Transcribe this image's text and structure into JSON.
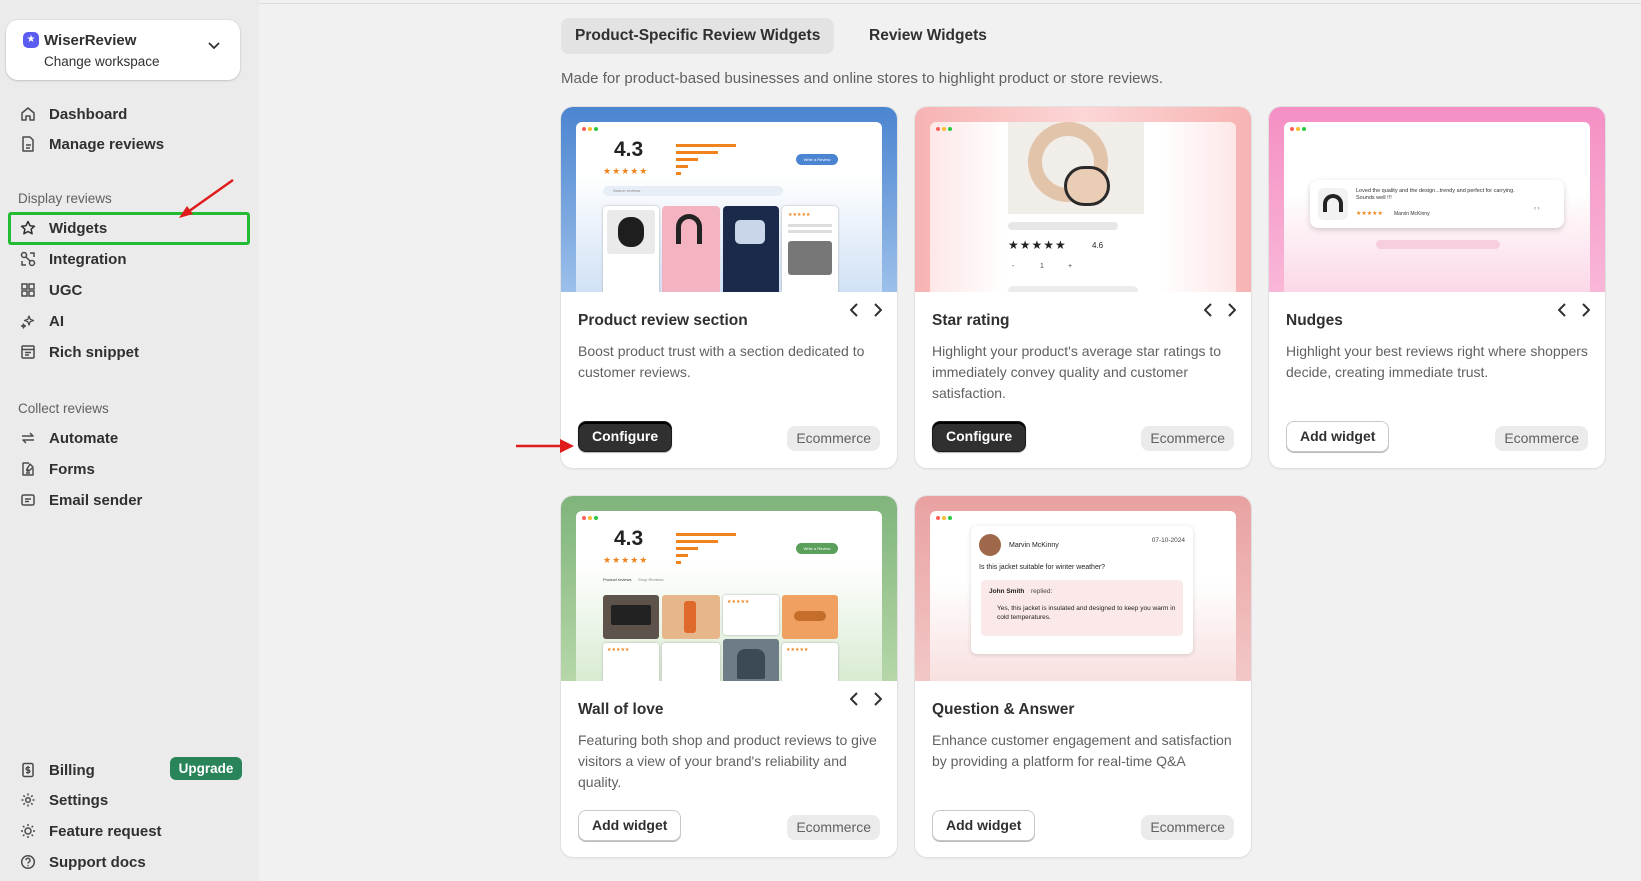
{
  "workspace": {
    "name": "WiserReview",
    "subtitle": "Change workspace"
  },
  "nav_main": [
    {
      "label": "Dashboard",
      "icon": "home-icon"
    },
    {
      "label": "Manage reviews",
      "icon": "document-icon"
    }
  ],
  "section_display": "Display reviews",
  "nav_display": [
    {
      "label": "Widgets",
      "icon": "star-icon"
    },
    {
      "label": "Integration",
      "icon": "integration-icon"
    },
    {
      "label": "UGC",
      "icon": "grid-icon"
    },
    {
      "label": "AI",
      "icon": "sparkle-icon"
    },
    {
      "label": "Rich snippet",
      "icon": "snippet-icon"
    }
  ],
  "section_collect": "Collect reviews",
  "nav_collect": [
    {
      "label": "Automate",
      "icon": "automate-icon"
    },
    {
      "label": "Forms",
      "icon": "form-icon"
    },
    {
      "label": "Email sender",
      "icon": "email-icon"
    }
  ],
  "nav_bottom": [
    {
      "label": "Billing",
      "icon": "billing-icon"
    },
    {
      "label": "Settings",
      "icon": "gear-icon"
    },
    {
      "label": "Feature request",
      "icon": "lightbulb-icon"
    },
    {
      "label": "Support docs",
      "icon": "help-icon"
    }
  ],
  "billing_badge": "Upgrade",
  "tabs": [
    "Product-Specific Review Widgets",
    "Review Widgets"
  ],
  "description": "Made for product-based businesses and online stores to highlight product or store reviews.",
  "colors": {
    "accent": "#303030",
    "highlight_box": "#22bb33",
    "arrow": "#e01b1b",
    "badge": "#29845a"
  },
  "cards": [
    {
      "title": "Product review section",
      "desc": "Boost product trust with a section dedicated to customer reviews.",
      "button": "Configure",
      "tag": "Ecommerce"
    },
    {
      "title": "Star rating",
      "desc": "Highlight your product's average star ratings to immediately convey quality and customer satisfaction.",
      "button": "Configure",
      "tag": "Ecommerce"
    },
    {
      "title": "Nudges",
      "desc": "Highlight your best reviews right where shoppers decide, creating immediate trust.",
      "button": "Add widget",
      "tag": "Ecommerce"
    },
    {
      "title": "Wall of love",
      "desc": "Featuring both shop and product reviews to give visitors a view of your brand's reliability and quality.",
      "button": "Add widget",
      "tag": "Ecommerce"
    },
    {
      "title": "Question & Answer",
      "desc": "Enhance customer engagement and satisfaction by providing a platform for real-time Q&A",
      "button": "Add widget",
      "tag": "Ecommerce"
    }
  ],
  "previews": {
    "review_rating": "4.3",
    "review_btn": "Write a Review",
    "review_search": "Search reviews",
    "star_value": "4.6",
    "star_minus": "-",
    "star_qty": "1",
    "star_plus": "+",
    "nudge_text": "Loved the quality and the design...trendy and perfect for carrying. Sounds well !!!",
    "nudge_author": "Marvin McKinny",
    "wall_rating": "4.3",
    "wall_tabs": [
      "Product reviews",
      "Shop Reviews"
    ],
    "wall_btn": "Write a Review",
    "qa_author": "Marvin McKinny",
    "qa_date": "07-10-2024",
    "qa_question": "Is this jacket suitable for winter weather?",
    "qa_replier": "John Smith",
    "qa_replied": "replied:",
    "qa_answer": "Yes, this jacket is insulated and designed to keep you warm in cold temperatures."
  }
}
